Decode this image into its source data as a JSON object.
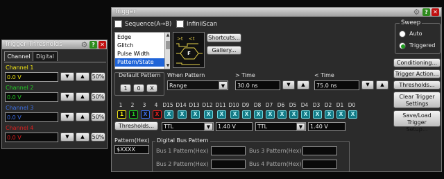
{
  "thresholds": {
    "title": "Trigger Thresholds",
    "tabs": [
      "Channel",
      "Digital"
    ],
    "channels": [
      {
        "label": "Channel 1",
        "value": "0.0 V",
        "color": "#f2e614"
      },
      {
        "label": "Channel 2",
        "value": "0.0 V",
        "color": "#22c822"
      },
      {
        "label": "Channel 3",
        "value": "0.0 V",
        "color": "#3c6ee6"
      },
      {
        "label": "Channel 4",
        "value": "0.0 V",
        "color": "#e01e1e"
      }
    ],
    "pct": "50%"
  },
  "trigger": {
    "title": "Trigger",
    "sequence_label": "Sequence(A→B)",
    "infiniiscan_label": "InfiniiScan",
    "types": [
      "Edge",
      "Glitch",
      "Pulse Width",
      "Pattern/State"
    ],
    "shortcuts": "Shortcuts...",
    "gallery": "Gallery...",
    "icon_letter": "F",
    "default_pattern_label": "Default Pattern",
    "default_buttons": [
      "1",
      "0",
      "X"
    ],
    "when_pattern_label": "When Pattern",
    "when_value": "Range",
    "gt_time_label": "> Time",
    "gt_time_value": "30.0 ns",
    "lt_time_label": "< Time",
    "lt_time_value": "75.0 ns",
    "bit_labels": [
      "1",
      "2",
      "3",
      "4",
      "D15",
      "D14",
      "D13",
      "D12",
      "D11",
      "D10",
      "D9",
      "D8",
      "D7",
      "D6",
      "D5",
      "D4",
      "D3",
      "D2",
      "D1",
      "D0"
    ],
    "bit_values": [
      "1",
      "1",
      "X",
      "X",
      "X",
      "X",
      "X",
      "X",
      "X",
      "X",
      "X",
      "X",
      "X",
      "X",
      "X",
      "X",
      "X",
      "X",
      "X",
      "X"
    ],
    "thresholds_btn": "Thresholds...",
    "th1_type": "TTL",
    "th1_value": "1.40 V",
    "th2_type": "TTL",
    "th2_value": "1.40 V",
    "pattern_hex_label": "Pattern(Hex)",
    "pattern_hex_value": "$XXXX",
    "digital_bus_label": "Digital Bus Pattern",
    "bus1": "Bus 1 Pattern(Hex)",
    "bus2": "Bus 2 Pattern(Hex)",
    "bus3": "Bus 3 Pattern(Hex)",
    "bus4": "Bus 4 Pattern(Hex)"
  },
  "sweep": {
    "label": "Sweep",
    "options": [
      "Auto",
      "Triggered"
    ],
    "selected": "Triggered"
  },
  "side_buttons": [
    "Conditioning...",
    "Trigger Action...",
    "Thresholds...",
    "Clear Trigger Settings",
    "Save/Load Trigger Setup..."
  ]
}
